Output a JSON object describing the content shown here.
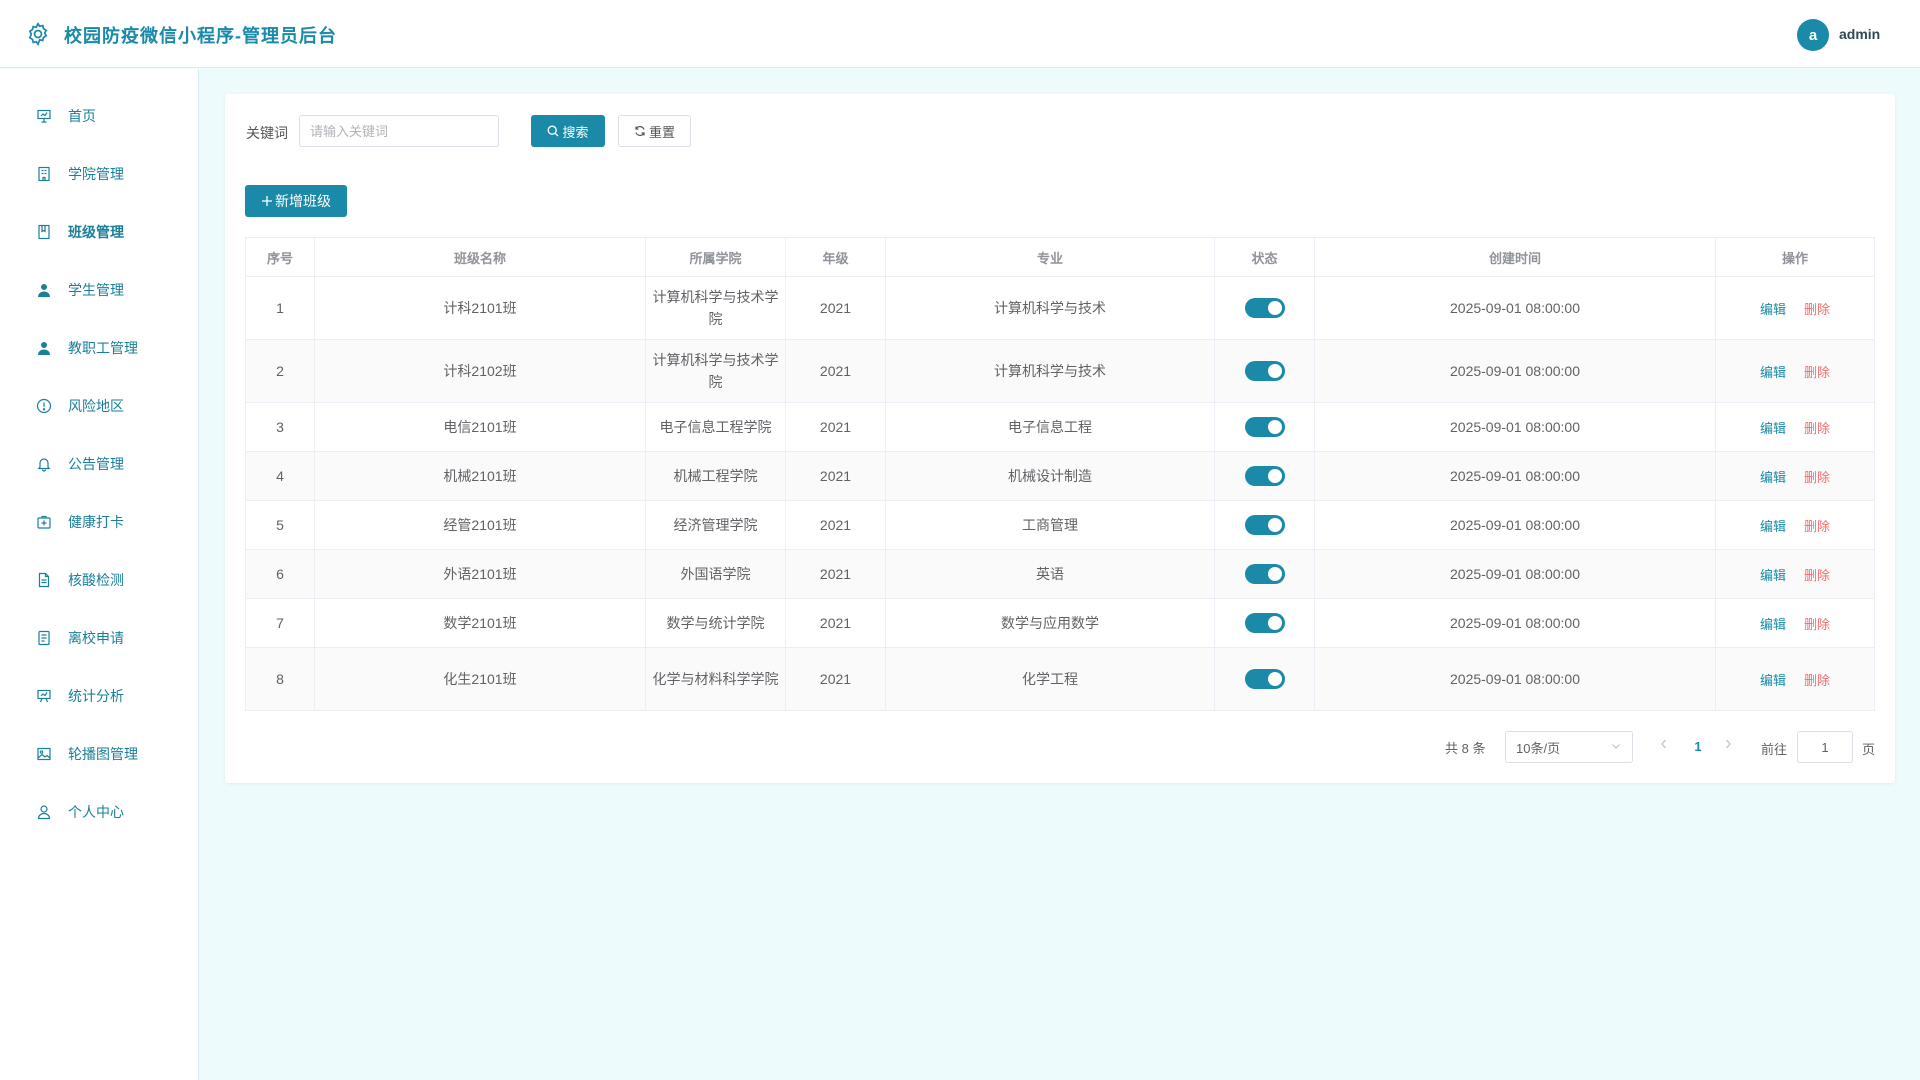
{
  "header": {
    "title": "校园防疫微信小程序-管理员后台",
    "avatar_letter": "a",
    "user": "admin",
    "accent": "#1a8aa8"
  },
  "sidebar": {
    "items": [
      {
        "label": "首页",
        "icon": "presentation-icon"
      },
      {
        "label": "学院管理",
        "icon": "building-icon"
      },
      {
        "label": "班级管理",
        "icon": "book-icon"
      },
      {
        "label": "学生管理",
        "icon": "user-filled-icon"
      },
      {
        "label": "教职工管理",
        "icon": "user-filled-icon"
      },
      {
        "label": "风险地区",
        "icon": "warning-circle-icon"
      },
      {
        "label": "公告管理",
        "icon": "bell-icon"
      },
      {
        "label": "健康打卡",
        "icon": "first-aid-kit-icon"
      },
      {
        "label": "核酸检测",
        "icon": "document-icon"
      },
      {
        "label": "离校申请",
        "icon": "list-document-icon"
      },
      {
        "label": "统计分析",
        "icon": "chart-board-icon"
      },
      {
        "label": "轮播图管理",
        "icon": "picture-icon"
      },
      {
        "label": "个人中心",
        "icon": "user-outline-icon"
      }
    ],
    "active_index": 2
  },
  "filter": {
    "keyword_label": "关键词",
    "keyword_placeholder": "请输入关键词",
    "keyword_value": "",
    "search_label": "搜索",
    "reset_label": "重置",
    "add_label": "新增班级"
  },
  "table": {
    "columns": [
      "序号",
      "班级名称",
      "所属学院",
      "年级",
      "专业",
      "状态",
      "创建时间",
      "操作"
    ],
    "edit_label": "编辑",
    "delete_label": "删除",
    "rows": [
      {
        "no": "1",
        "name": "计科2101班",
        "college": "计算机科学与技术学院",
        "grade": "2021",
        "major": "计算机科学与技术",
        "enabled": true,
        "created": "2025-09-01 08:00:00"
      },
      {
        "no": "2",
        "name": "计科2102班",
        "college": "计算机科学与技术学院",
        "grade": "2021",
        "major": "计算机科学与技术",
        "enabled": true,
        "created": "2025-09-01 08:00:00"
      },
      {
        "no": "3",
        "name": "电信2101班",
        "college": "电子信息工程学院",
        "grade": "2021",
        "major": "电子信息工程",
        "enabled": true,
        "created": "2025-09-01 08:00:00"
      },
      {
        "no": "4",
        "name": "机械2101班",
        "college": "机械工程学院",
        "grade": "2021",
        "major": "机械设计制造",
        "enabled": true,
        "created": "2025-09-01 08:00:00"
      },
      {
        "no": "5",
        "name": "经管2101班",
        "college": "经济管理学院",
        "grade": "2021",
        "major": "工商管理",
        "enabled": true,
        "created": "2025-09-01 08:00:00"
      },
      {
        "no": "6",
        "name": "外语2101班",
        "college": "外国语学院",
        "grade": "2021",
        "major": "英语",
        "enabled": true,
        "created": "2025-09-01 08:00:00"
      },
      {
        "no": "7",
        "name": "数学2101班",
        "college": "数学与统计学院",
        "grade": "2021",
        "major": "数学与应用数学",
        "enabled": true,
        "created": "2025-09-01 08:00:00"
      },
      {
        "no": "8",
        "name": "化生2101班",
        "college": "化学与材料科学学院",
        "grade": "2021",
        "major": "化学工程",
        "enabled": true,
        "created": "2025-09-01 08:00:00"
      }
    ]
  },
  "pagination": {
    "total": "共 8 条",
    "page_size": "10条/页",
    "current_page": "1",
    "goto_label": "前往",
    "goto_value": "1",
    "page_unit": "页"
  }
}
